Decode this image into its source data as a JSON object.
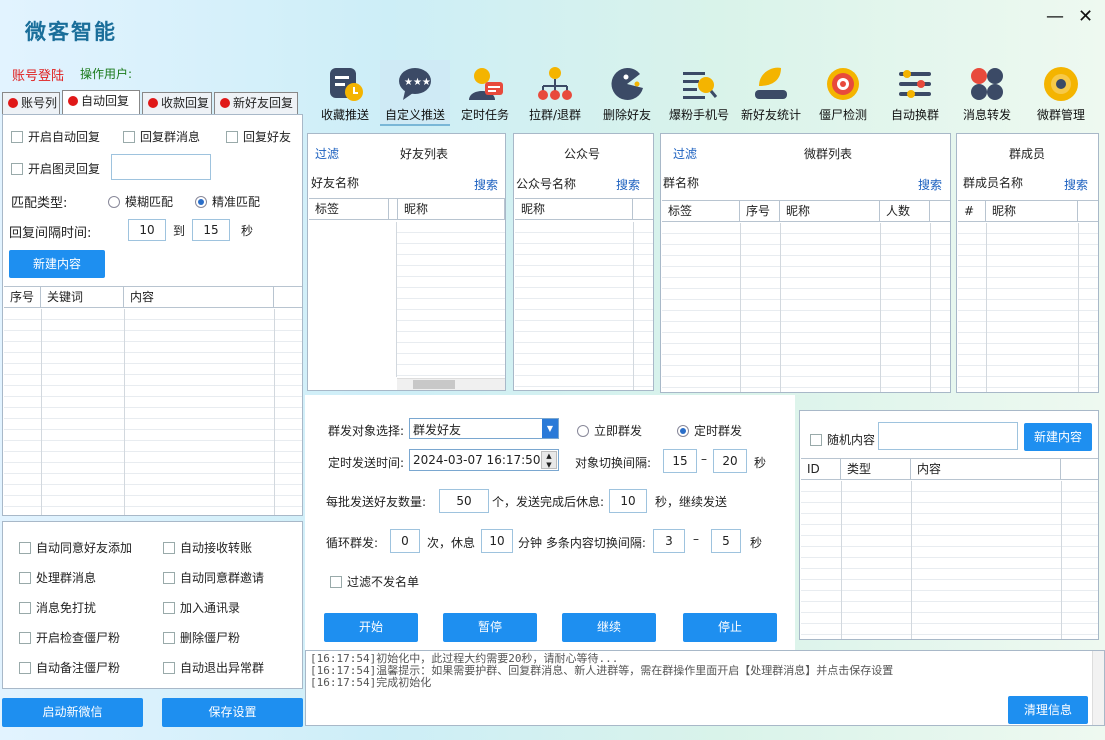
{
  "app": {
    "title": "微客智能",
    "account_login": "账号登陆",
    "operator_label": "操作用户:"
  },
  "toolbar": [
    {
      "label": "收藏推送",
      "icon": "favorites-push-icon"
    },
    {
      "label": "自定义推送",
      "icon": "custom-push-icon"
    },
    {
      "label": "定时任务",
      "icon": "scheduled-task-icon"
    },
    {
      "label": "拉群/退群",
      "icon": "group-join-leave-icon"
    },
    {
      "label": "删除好友",
      "icon": "delete-friend-icon"
    },
    {
      "label": "爆粉手机号",
      "icon": "phone-search-icon"
    },
    {
      "label": "新好友统计",
      "icon": "new-friend-stats-icon"
    },
    {
      "label": "僵尸检测",
      "icon": "zombie-detect-icon"
    },
    {
      "label": "自动换群",
      "icon": "auto-switch-group-icon"
    },
    {
      "label": "消息转发",
      "icon": "message-forward-icon"
    },
    {
      "label": "微群管理",
      "icon": "group-manage-icon"
    }
  ],
  "left_tabs": [
    "账号列",
    "自动回复",
    "收款回复",
    "新好友回复"
  ],
  "auto_reply": {
    "enable_auto_reply": "开启自动回复",
    "reply_group_msg": "回复群消息",
    "reply_friend": "回复好友",
    "enable_image_reply": "开启图灵回复",
    "match_type_label": "匹配类型:",
    "fuzzy_match": "模糊匹配",
    "exact_match": "精准匹配",
    "interval_label": "回复间隔时间:",
    "interval_from": "10",
    "to_label": "到",
    "interval_to": "15",
    "sec_label": "秒",
    "new_content_btn": "新建内容",
    "table_headers": [
      "序号",
      "关键词",
      "内容"
    ]
  },
  "options": [
    "自动同意好友添加",
    "自动接收转账",
    "处理群消息",
    "自动同意群邀请",
    "消息免打扰",
    "加入通讯录",
    "开启检查僵尸粉",
    "删除僵尸粉",
    "自动备注僵尸粉",
    "自动退出异常群"
  ],
  "bottom_buttons": {
    "start_wechat": "启动新微信",
    "save_settings": "保存设置"
  },
  "friends_panel": {
    "filter": "过滤",
    "title": "好友列表",
    "name_label": "好友名称",
    "search": "搜索",
    "headers": [
      "标签",
      "昵称"
    ]
  },
  "public_panel": {
    "title": "公众号",
    "name_label": "公众号名称",
    "search": "搜索",
    "headers": [
      "昵称"
    ]
  },
  "groups_panel": {
    "filter": "过滤",
    "title": "微群列表",
    "name_label": "群名称",
    "search": "搜索",
    "headers": [
      "标签",
      "序号",
      "昵称",
      "人数"
    ]
  },
  "members_panel": {
    "title": "群成员",
    "name_label": "群成员名称",
    "search": "搜索",
    "headers": [
      "#",
      "昵称"
    ]
  },
  "send": {
    "target_label": "群发对象选择:",
    "target_value": "群发好友",
    "immediate": "立即群发",
    "scheduled": "定时群发",
    "send_time_label": "定时发送时间:",
    "send_time_value": "2024-03-07 16:17:50",
    "switch_interval_label": "对象切换间隔:",
    "switch_from": "15",
    "dash": "–",
    "switch_to": "20",
    "sec": "秒",
    "batch_label": "每批发送好友数量:",
    "batch_value": "50",
    "batch_mid": "个，发送完成后休息:",
    "rest_value": "10",
    "batch_tail": "秒，继续发送",
    "loop_label": "循环群发:",
    "loop_value": "0",
    "loop_mid": "次，休息",
    "loop_rest": "10",
    "loop_tail": "分钟  多条内容切换间隔:",
    "content_from": "3",
    "dash2": "–",
    "content_to": "5",
    "sec2": "秒",
    "skip_unsent": "过滤不发名单",
    "start": "开始",
    "pause": "暂停",
    "resume": "继续",
    "stop": "停止"
  },
  "content_panel": {
    "random_content": "随机内容",
    "new_content": "新建内容",
    "headers": [
      "ID",
      "类型",
      "内容"
    ]
  },
  "log": {
    "lines": [
      "[16:17:54]初始化中，此过程大约需要20秒，请耐心等待...",
      "[16:17:54]温馨提示：如果需要护群、回复群消息、新人进群等，需在群操作里面开启【处理群消息】并点击保存设置",
      "[16:17:54]完成初始化"
    ],
    "clear_btn": "清理信息"
  },
  "colors": {
    "accent": "#1e8ff0",
    "title": "#1a6e9a",
    "login_red": "#e02020",
    "link_blue": "#1a5fbf"
  }
}
